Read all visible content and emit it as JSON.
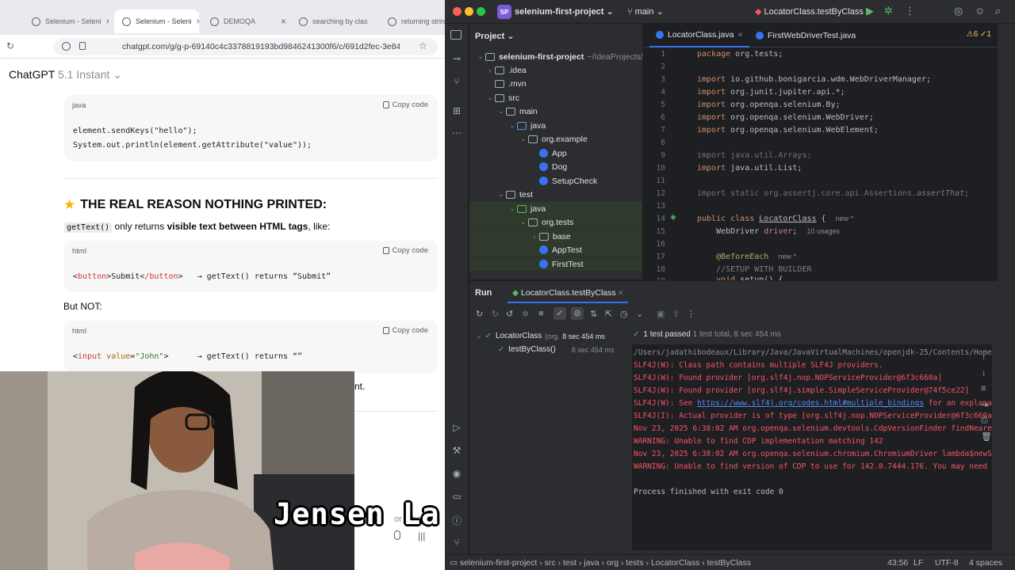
{
  "browser": {
    "tabs": [
      "Selenium - Seleni",
      "Selenium - Seleni",
      "DEMOQA",
      "searching by clas",
      "returning string"
    ],
    "url": "chatgpt.com/g/g-p-69140c4c3378819193bd9846241300f6/c/691d2fec-3e84"
  },
  "chat": {
    "model_name": "ChatGPT",
    "model_version": "5.1 Instant",
    "copy_label": "Copy code",
    "block1": {
      "lang": "java",
      "line1": "element.sendKeys(\"hello\");",
      "line2": "System.out.println(element.getAttribute(\"value\"));"
    },
    "heading": "THE REAL REASON NOTHING PRINTED:",
    "explain_code": "getText()",
    "explain_mid": "only returns",
    "explain_bold": "visible text between HTML tags",
    "explain_end": ", like:",
    "block2": {
      "lang": "html",
      "open_tag": "button",
      "text": "Submit",
      "close_tag": "/button",
      "rest": "→ getText() returns “Submit”"
    },
    "but_not": "But NOT:",
    "block3": {
      "lang": "html",
      "tag": "input",
      "attr": "value",
      "val": "\"John\"",
      "rest": "→ getText() returns “”"
    },
    "tail": "nt.",
    "composer_text": "or other"
  },
  "caption": "Jensen La",
  "ide": {
    "project_badge": "SP",
    "project_name": "selenium-first-project",
    "branch": "main",
    "run_config": "LocatorClass.testByClass",
    "project_panel_title": "Project",
    "tree": [
      {
        "label": "selenium-first-project",
        "hint": "~/IdeaProjects/s"
      },
      {
        "label": ".idea"
      },
      {
        "label": ".mvn"
      },
      {
        "label": "src"
      },
      {
        "label": "main"
      },
      {
        "label": "java"
      },
      {
        "label": "org.example"
      },
      {
        "label": "App"
      },
      {
        "label": "Dog"
      },
      {
        "label": "SetupCheck"
      },
      {
        "label": "test"
      },
      {
        "label": "java"
      },
      {
        "label": "org.tests"
      },
      {
        "label": "base"
      },
      {
        "label": "AppTest"
      },
      {
        "label": "FirstTest"
      }
    ],
    "editor_tabs": [
      "LocatorClass.java",
      "FirstWebDriverTest.java"
    ],
    "inspections": "⚠6 ✓1",
    "code": {
      "l1a": "package",
      "l1b": " org.tests;",
      "l3b": " io.github.bonigarcia.wdm.WebDriverManager;",
      "l4b": " org.junit.jupiter.api.*;",
      "l5b": " org.openqa.selenium.By;",
      "l6b": " org.openqa.selenium.WebDriver;",
      "l7b": " org.openqa.selenium.WebElement;",
      "kw_import": "import",
      "l9": "import java.util.Arrays;",
      "l10b": " java.util.List;",
      "l12": "import static org.assertj.core.api.Assertions.",
      "l12i": "assertThat",
      "l12e": ";",
      "kw_public": "public",
      "kw_class": " class ",
      "l14cls": "LocatorClass",
      "l14e": " {",
      "new_hint": "new *",
      "l15a": "    WebDriver ",
      "l15b": "driver",
      "l15c": ";",
      "usages": "10 usages",
      "l17": "    @BeforeEach",
      "l18": "    //SETUP WITH BUILDER",
      "l19a": "    ",
      "kw_void": "void",
      "l19b": " setup() {"
    },
    "run_tab_label": "Run",
    "run_config_tab": "LocatorClass.testByClass",
    "tests": [
      {
        "name": "LocatorClass",
        "pkg": "(org.te",
        "duration": "8 sec 454 ms"
      },
      {
        "name": "testByClass()",
        "duration": "8 sec 454 ms"
      }
    ],
    "pass_summary": "1 test passed",
    "pass_detail": "1 test total, 8 sec 454 ms",
    "console": [
      "/Users/jadathibodeaux/Library/Java/JavaVirtualMachines/openjdk-25/Contents/Home",
      "SLF4J(W): Class path contains multiple SLF4J providers.",
      "SLF4J(W): Found provider [org.slf4j.nop.NOPServiceProvider@6f3c660a]",
      "SLF4J(W): Found provider [org.slf4j.simple.SimpleServiceProvider@74f5ce22]",
      "SLF4J(W): See ",
      "https://www.slf4j.org/codes.html#multiple_bindings",
      " for an explana",
      "SLF4J(I): Actual provider is of type [org.slf4j.nop.NOPServiceProvider@6f3c660a",
      "Nov 23, 2025 6:38:02 AM org.openqa.selenium.devtools.CdpVersionFinder findNeare",
      "WARNING: Unable to find CDP implementation matching 142",
      "Nov 23, 2025 6:38:02 AM org.openqa.selenium.chromium.ChromiumDriver lambda$newS",
      "WARNING: Unable to find version of CDP to use for 142.0.7444.176. You may need",
      "Process finished with exit code 0"
    ],
    "breadcrumb": [
      "selenium-first-project",
      "src",
      "test",
      "java",
      "org",
      "tests",
      "LocatorClass",
      "testByClass"
    ],
    "cursor_pos": "43:56",
    "line_sep": "LF",
    "encoding": "UTF-8",
    "indent": "4 spaces"
  }
}
